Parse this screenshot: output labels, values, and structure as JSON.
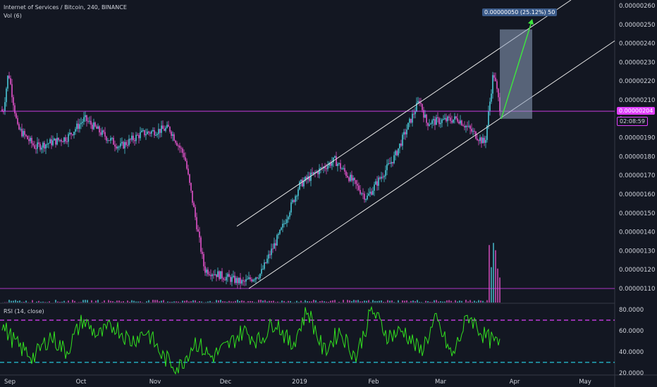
{
  "header": {
    "symbol_line": "Internet of Services / Bitcoin, 240, BINANCE",
    "volume_label": "Vol (6)"
  },
  "rsi": {
    "label": "RSI (14, close)",
    "upper_band": 70,
    "lower_band": 30,
    "ticks": [
      "80.0000",
      "60.0000",
      "40.0000",
      "20.0000"
    ]
  },
  "price_axis": {
    "ticks": [
      "0.00000260",
      "0.00000250",
      "0.00000240",
      "0.00000230",
      "0.00000220",
      "0.00000210",
      "0",
      "0.00000190",
      "0.00000180",
      "0.00000170",
      "0.00000160",
      "0.00000150",
      "0.00000140",
      "0.00000130",
      "0.00000120",
      "0.00000110"
    ],
    "current_price": "0.00000204",
    "countdown": "02:08:59"
  },
  "projection_label": "0.00000050 (25.12%) 50",
  "colors": {
    "background": "#131722",
    "up": "#4bc8d9",
    "down": "#e052c8",
    "price_line": "#e040fb",
    "rsi_line": "#32e01f",
    "rsi_upper": "#e040fb",
    "rsi_lower": "#26c6da",
    "projection_box": "#8fa3bf",
    "projection_arrow": "#3de83d",
    "label_bg": "#3b5b8a"
  },
  "chart_data": [
    {
      "type": "candlestick",
      "title": "Internet of Services / Bitcoin, 240, BINANCE",
      "x_ticks": [
        "Sep",
        "Oct",
        "Nov",
        "Dec",
        "2019",
        "Feb",
        "Mar",
        "Apr",
        "May"
      ],
      "y_ticks": [
        2.6e-06,
        2.5e-06,
        2.4e-06,
        2.3e-06,
        2.2e-06,
        2.1e-06,
        1.9e-06,
        1.8e-06,
        1.7e-06,
        1.6e-06,
        1.5e-06,
        1.4e-06,
        1.3e-06,
        1.2e-06,
        1.1e-06
      ],
      "ylim": [
        1.055e-06,
        2.625e-06
      ],
      "current_price": 2.04e-06,
      "approx_close_path": [
        [
          "Sep",
          2.15e-06
        ],
        [
          "Sep",
          2.3e-06
        ],
        [
          "Sep",
          1.85e-06
        ],
        [
          "Sep",
          1.8e-06
        ],
        [
          "Oct",
          1.95e-06
        ],
        [
          "Oct",
          1.95e-06
        ],
        [
          "Oct",
          1.9e-06
        ],
        [
          "Nov",
          1.95e-06
        ],
        [
          "Nov",
          1.8e-06
        ],
        [
          "Nov",
          1.3e-06
        ],
        [
          "Nov",
          1.2e-06
        ],
        [
          "Dec",
          1.18e-06
        ],
        [
          "Dec",
          1.14e-06
        ],
        [
          "Dec",
          1.18e-06
        ],
        [
          "Dec",
          1.4e-06
        ],
        [
          "Dec",
          1.6e-06
        ],
        [
          "2019",
          1.75e-06
        ],
        [
          "2019",
          1.7e-06
        ],
        [
          "2019",
          1.8e-06
        ],
        [
          "Feb",
          1.6e-06
        ],
        [
          "Feb",
          1.8e-06
        ],
        [
          "Feb",
          2.1e-06
        ],
        [
          "Feb",
          1.95e-06
        ],
        [
          "Mar",
          2e-06
        ],
        [
          "Mar",
          1.95e-06
        ],
        [
          "Mar",
          1.87e-06
        ],
        [
          "Mar",
          2.25e-06
        ],
        [
          "Mar",
          2.04e-06
        ]
      ],
      "ascending_channel": {
        "upper": [
          [
            "Dec",
            1.43e-06
          ],
          [
            "Apr",
            2.6e-06
          ]
        ],
        "lower": [
          [
            "Dec",
            1.1e-06
          ],
          [
            "Apr",
            2.4e-06
          ]
        ]
      },
      "projection": {
        "from": 2e-06,
        "to": 2.5e-06,
        "change": "0.00000050",
        "percent": "25.12%",
        "bars": 50
      }
    },
    {
      "type": "line",
      "title": "RSI (14, close)",
      "y_ticks": [
        80,
        60,
        40,
        20
      ],
      "ylim": [
        13,
        87
      ],
      "bands": [
        70,
        30
      ],
      "approx_values": [
        65,
        45,
        35,
        55,
        40,
        70,
        55,
        65,
        50,
        60,
        35,
        25,
        50,
        35,
        45,
        60,
        50,
        70,
        45,
        80,
        40,
        60,
        35,
        80,
        55,
        60,
        40,
        70,
        35,
        75,
        55,
        45
      ]
    }
  ]
}
